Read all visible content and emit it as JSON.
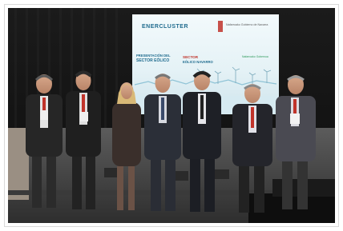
{
  "photo": {
    "screen": {
      "brand": "ENERCLUSTER",
      "brand_sub": "",
      "left_heading": "PRESENTACIÓN DEL",
      "left_heading_2": "SECTOR EÓLICO",
      "mid_heading": "SECTOR",
      "mid_heading_2": "EÓLICO NAVARRO",
      "right_heading": "",
      "logo_text": "Nafarroako Gobierno de Navarra",
      "right_small": "Nafarroako Gobernua"
    },
    "colors": {
      "screen_bg": "#e7f3f7",
      "screen_accent": "#1f6b8e",
      "red_accent": "#c0332a",
      "green_accent": "#2f9a5c"
    }
  }
}
